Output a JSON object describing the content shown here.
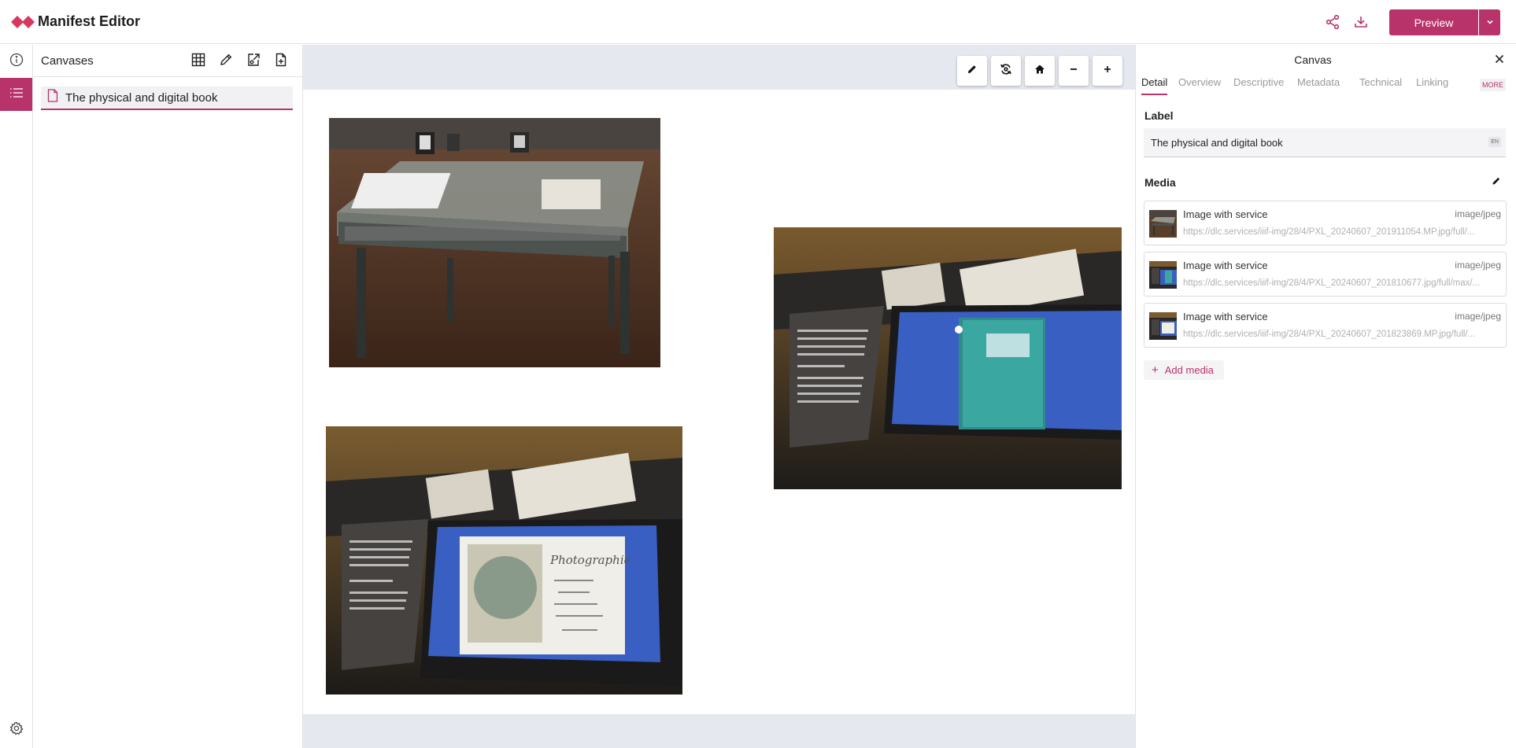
{
  "header": {
    "app_title": "Manifest Editor",
    "preview_label": "Preview",
    "icons": [
      "share-icon",
      "download-icon",
      "chevron-down-icon"
    ],
    "accent_color": "#b8336a"
  },
  "left_rail": {
    "items": [
      {
        "icon": "info-icon"
      },
      {
        "icon": "list-icon",
        "active": true
      }
    ],
    "bottom_icon": "settings-icon"
  },
  "sidebar": {
    "title": "Canvases",
    "tools": [
      "grid-icon",
      "edit-icon",
      "export-icon",
      "add-file-icon"
    ],
    "canvases": [
      {
        "label": "The physical and digital book",
        "icon": "file-icon"
      }
    ]
  },
  "viewer": {
    "tools": [
      "edit-icon",
      "reset-icon",
      "home-icon",
      "zoom-out-icon",
      "zoom-in-icon"
    ],
    "images": [
      {
        "name": "photo-exhibit-case"
      },
      {
        "name": "photo-album-screen-green"
      },
      {
        "name": "photo-album-screen-photographie"
      }
    ]
  },
  "panel": {
    "title": "Canvas",
    "tabs": [
      {
        "label": "Detail",
        "active": true
      },
      {
        "label": "Overview"
      },
      {
        "label": "Descriptive"
      },
      {
        "label": "Metadata"
      },
      {
        "label": "Technical"
      },
      {
        "label": "Linking"
      }
    ],
    "more_label": "MORE",
    "label_heading": "Label",
    "label_value": "The physical and digital book",
    "label_lang": "EN",
    "media_heading": "Media",
    "media": [
      {
        "name": "Image with service",
        "type": "image/jpeg",
        "url": "https://dlc.services/iiif-img/28/4/PXL_20240607_201911054.MP.jpg/full/..."
      },
      {
        "name": "Image with service",
        "type": "image/jpeg",
        "url": "https://dlc.services/iiif-img/28/4/PXL_20240607_201810677.jpg/full/max/..."
      },
      {
        "name": "Image with service",
        "type": "image/jpeg",
        "url": "https://dlc.services/iiif-img/28/4/PXL_20240607_201823869.MP.jpg/full/..."
      }
    ],
    "add_media_label": "Add media"
  }
}
